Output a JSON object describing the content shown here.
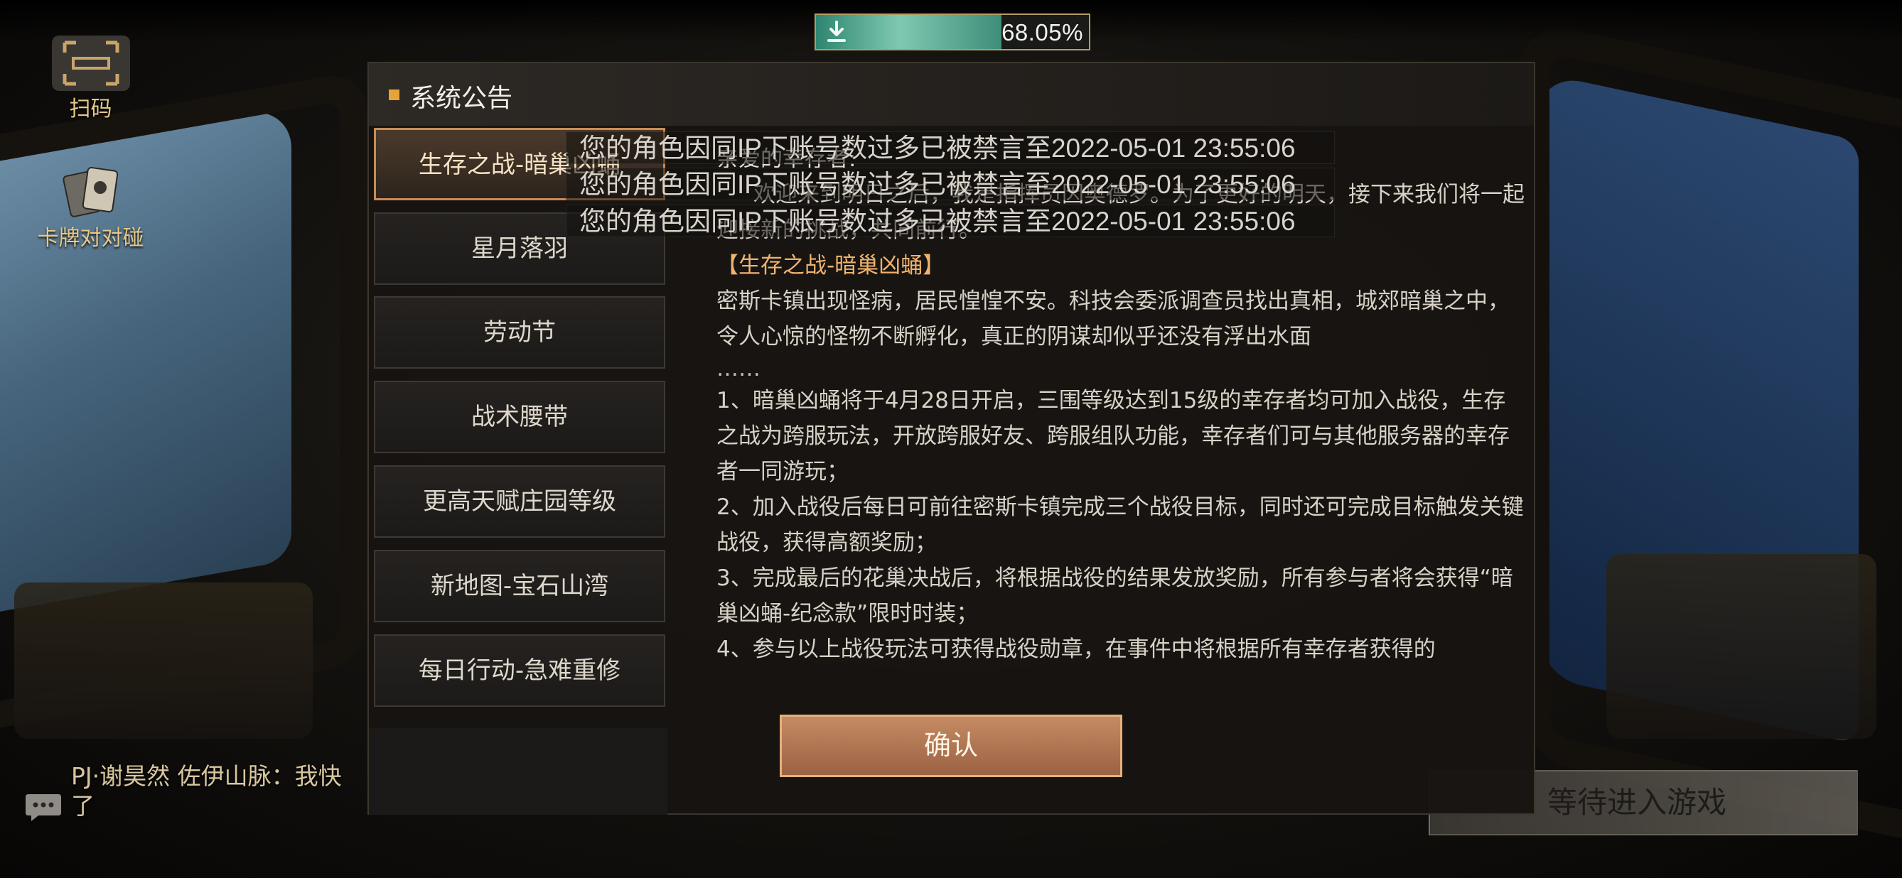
{
  "download": {
    "percent_text": "68.05%",
    "progress": 0.6805
  },
  "shortcuts": [
    {
      "label": "扫码",
      "icon": "scan-icon"
    },
    {
      "label": "卡牌对对碰",
      "icon": "cards-icon"
    }
  ],
  "chat": {
    "message": "PJ·谢昊然 佐伊山脉：我快\n了"
  },
  "wait_button": {
    "label": "等待进入游戏"
  },
  "dialog": {
    "title": "系统公告",
    "tabs": [
      {
        "label": "生存之战-暗巢凶蛹",
        "active": true
      },
      {
        "label": "星月落羽"
      },
      {
        "label": "劳动节"
      },
      {
        "label": "战术腰带"
      },
      {
        "label": "更高天赋庄园等级"
      },
      {
        "label": "新地图-宝石山湾"
      },
      {
        "label": "每日行动-急难重修"
      }
    ],
    "content": {
      "greeting": "亲爱的幸存者:",
      "welcome": "欢迎来到明日之后，我是指挥员因奥德罗。为了更好的明天，接下来我们将一起迎接新的挑战，共同前行。",
      "event_title": "【生存之战-暗巢凶蛹】",
      "intro": "密斯卡镇出现怪病，居民惶惶不安。科技会委派调查员找出真相，城郊暗巢之中，令人心惊的怪物不断孵化，真正的阴谋却似乎还没有浮出水面",
      "ellipsis": "……",
      "items": [
        "1、暗巢凶蛹将于4月28日开启，三围等级达到15级的幸存者均可加入战役，生存之战为跨服玩法，开放跨服好友、跨服组队功能，幸存者们可与其他服务器的幸存者一同游玩；",
        "2、加入战役后每日可前往密斯卡镇完成三个战役目标，同时还可完成目标触发关键战役，获得高额奖励；",
        "3、完成最后的花巢决战后，将根据战役的结果发放奖励，所有参与者将会获得“暗巢凶蛹-纪念款”限时时装；",
        "4、参与以上战役玩法可获得战役勋章，在事件中将根据所有幸存者获得的"
      ]
    },
    "confirm_label": "确认"
  },
  "toasts": [
    "您的角色因同IP下账号数过多已被禁言至2022-05-01 23:55:06",
    "您的角色因同IP下账号数过多已被禁言至2022-05-01 23:55:06",
    "您的角色因同IP下账号数过多已被禁言至2022-05-01 23:55:06"
  ]
}
